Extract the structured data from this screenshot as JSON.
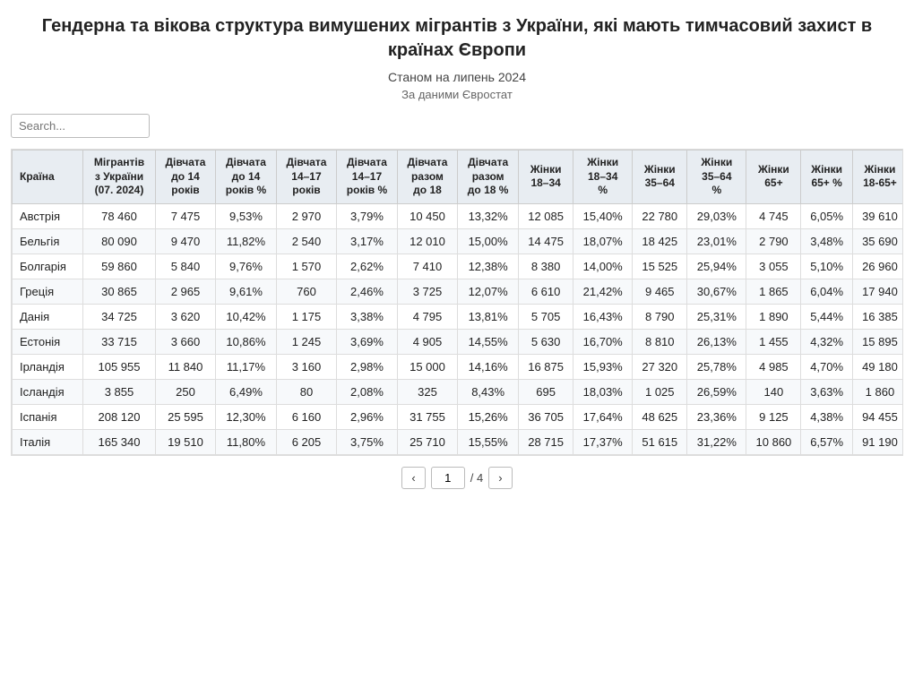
{
  "header": {
    "title": "Гендерна та вікова структура вимушених мігрантів з України, які мають тимчасовий захист в країнах Європи",
    "subtitle": "Станом на липень 2024",
    "source": "За даними Євростат"
  },
  "search": {
    "placeholder": "Search..."
  },
  "table": {
    "columns": [
      "Країна",
      "Мігрантів з України (07. 2024)",
      "Дівчата до 14 років",
      "Дівчата до 14 років %",
      "Дівчата 14–17 років",
      "Дівчата 14–17 років %",
      "Дівчата разом до 18",
      "Дівчата разом до 18 %",
      "Жінки 18–34",
      "Жінки 18–34 %",
      "Жінки 35–64",
      "Жінки 35–64 %",
      "Жінки 65+",
      "Жінки 65+ %",
      "Жінки 18-65+"
    ],
    "rows": [
      [
        "Австрія",
        "78 460",
        "7 475",
        "9,53%",
        "2 970",
        "3,79%",
        "10 450",
        "13,32%",
        "12 085",
        "15,40%",
        "22 780",
        "29,03%",
        "4 745",
        "6,05%",
        "39 610"
      ],
      [
        "Бельгія",
        "80 090",
        "9 470",
        "11,82%",
        "2 540",
        "3,17%",
        "12 010",
        "15,00%",
        "14 475",
        "18,07%",
        "18 425",
        "23,01%",
        "2 790",
        "3,48%",
        "35 690"
      ],
      [
        "Болгарія",
        "59 860",
        "5 840",
        "9,76%",
        "1 570",
        "2,62%",
        "7 410",
        "12,38%",
        "8 380",
        "14,00%",
        "15 525",
        "25,94%",
        "3 055",
        "5,10%",
        "26 960"
      ],
      [
        "Греція",
        "30 865",
        "2 965",
        "9,61%",
        "760",
        "2,46%",
        "3 725",
        "12,07%",
        "6 610",
        "21,42%",
        "9 465",
        "30,67%",
        "1 865",
        "6,04%",
        "17 940"
      ],
      [
        "Данія",
        "34 725",
        "3 620",
        "10,42%",
        "1 175",
        "3,38%",
        "4 795",
        "13,81%",
        "5 705",
        "16,43%",
        "8 790",
        "25,31%",
        "1 890",
        "5,44%",
        "16 385"
      ],
      [
        "Естонія",
        "33 715",
        "3 660",
        "10,86%",
        "1 245",
        "3,69%",
        "4 905",
        "14,55%",
        "5 630",
        "16,70%",
        "8 810",
        "26,13%",
        "1 455",
        "4,32%",
        "15 895"
      ],
      [
        "Ірландія",
        "105 955",
        "11 840",
        "11,17%",
        "3 160",
        "2,98%",
        "15 000",
        "14,16%",
        "16 875",
        "15,93%",
        "27 320",
        "25,78%",
        "4 985",
        "4,70%",
        "49 180"
      ],
      [
        "Ісландія",
        "3 855",
        "250",
        "6,49%",
        "80",
        "2,08%",
        "325",
        "8,43%",
        "695",
        "18,03%",
        "1 025",
        "26,59%",
        "140",
        "3,63%",
        "1 860"
      ],
      [
        "Іспанія",
        "208 120",
        "25 595",
        "12,30%",
        "6 160",
        "2,96%",
        "31 755",
        "15,26%",
        "36 705",
        "17,64%",
        "48 625",
        "23,36%",
        "9 125",
        "4,38%",
        "94 455"
      ],
      [
        "Італія",
        "165 340",
        "19 510",
        "11,80%",
        "6 205",
        "3,75%",
        "25 710",
        "15,55%",
        "28 715",
        "17,37%",
        "51 615",
        "31,22%",
        "10 860",
        "6,57%",
        "91 190"
      ]
    ]
  },
  "pagination": {
    "prev_label": "‹",
    "next_label": "›",
    "current_page": "1",
    "total_pages": "4",
    "separator": "/ 4"
  }
}
